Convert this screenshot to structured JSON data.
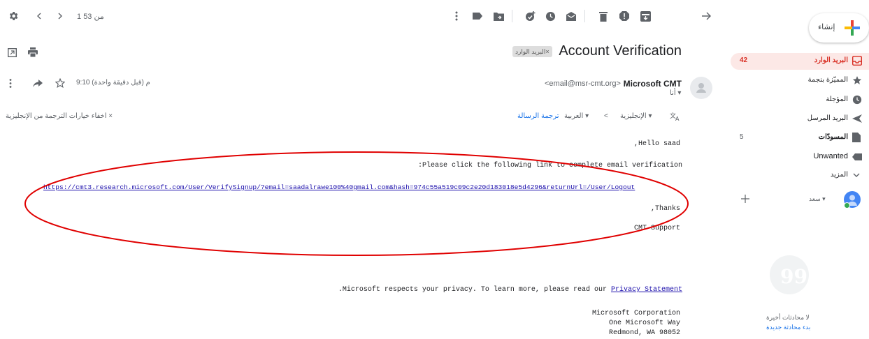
{
  "toolbar": {
    "pager_text": "1 من 53",
    "icons": [
      "settings-icon",
      "chevron-left-icon",
      "chevron-right-icon",
      "more-vert-icon",
      "label-icon",
      "move-to-icon",
      "snooze-add-icon",
      "clock-icon",
      "mark-unread-icon",
      "delete-icon",
      "report-spam-icon",
      "archive-icon",
      "back-arrow-icon"
    ]
  },
  "message": {
    "subject": "Account Verification",
    "label_chip": "البريد الوارد×",
    "sender_name": "Microsoft CMT",
    "sender_email": "<email@msr-cmt.org>",
    "to_me": "أنا ▾",
    "time": "9:10 م (قبل دقيقة واحدة)"
  },
  "translate": {
    "from_lang": "الإنجليزية ▾",
    "arrow": "<",
    "to_lang": "العربية ▾",
    "translate_link": "ترجمة الرسالة",
    "hide_options": "اخفاء خيارات الترجمة من الإنجليزية ×"
  },
  "body": {
    "greeting": ",Hello saad",
    "instruction": ":Please click the following link to complete email verification",
    "link": "https://cmt3.research.microsoft.com/User/VerifySignup/?email=saadalrawe100%40gmail.com&hash=974c55a519c09c2e20d183018e5d4296&returnUrl=/User/Logout",
    "thanks": ",Thanks",
    "signature": "CMT Support",
    "privacy_text": ".Microsoft respects your privacy. To learn more, please read our ",
    "privacy_link": "Privacy Statement",
    "address1": "Microsoft Corporation",
    "address2": "One Microsoft Way",
    "address3": "Redmond, WA 98052"
  },
  "sidebar": {
    "compose_label": "إنشاء",
    "items": [
      {
        "label": "البريد الوارد",
        "count": "42",
        "icon": "inbox-icon"
      },
      {
        "label": "المميّزة بنجمة",
        "count": "",
        "icon": "star-icon"
      },
      {
        "label": "المؤجلة",
        "count": "",
        "icon": "clock-icon"
      },
      {
        "label": "البريد المرسل",
        "count": "",
        "icon": "send-icon"
      },
      {
        "label": "المسودّات",
        "count": "5",
        "icon": "draft-icon"
      },
      {
        "label": "Unwanted",
        "count": "",
        "icon": "label-icon"
      },
      {
        "label": "المزيد",
        "count": "",
        "icon": "chevron-down-icon"
      }
    ],
    "user_name": "سعد ▾",
    "no_chats": "لا محادثات أخيرة",
    "start_chat": "بدء محادثة جديدة"
  },
  "colors": {
    "inbox_highlight": "#fce8e6",
    "inbox_red": "#d93025",
    "link_blue": "#1a73e8",
    "annotation_red": "#e00000"
  }
}
